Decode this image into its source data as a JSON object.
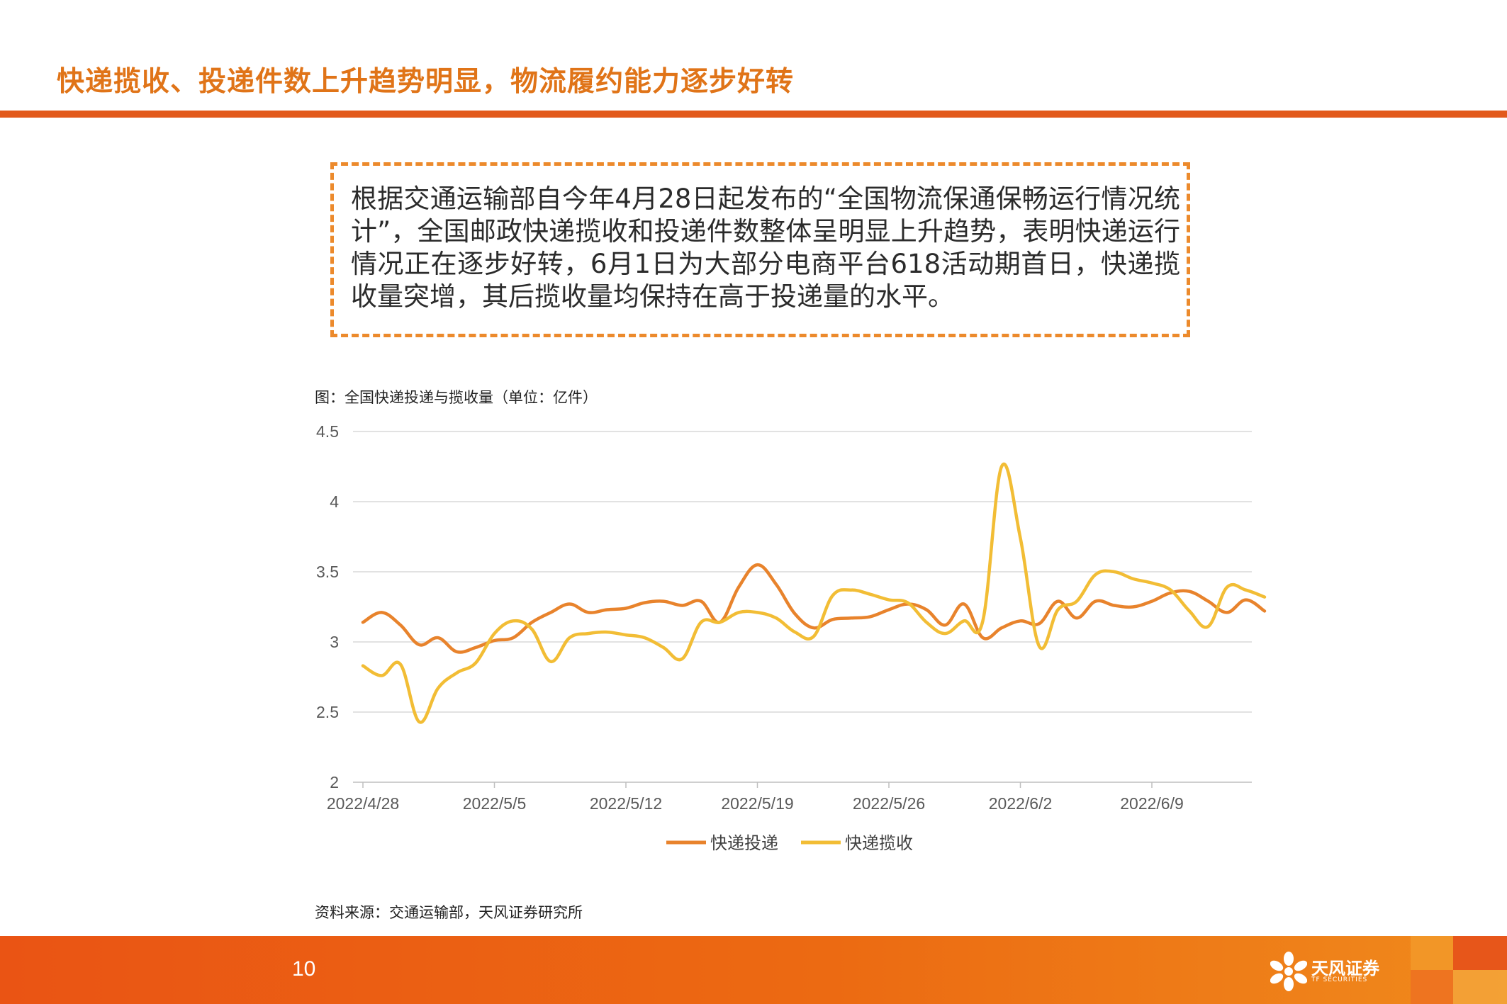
{
  "header": {
    "title": "快递揽收、投递件数上升趋势明显，物流履约能力逐步好转"
  },
  "callout": {
    "text": "根据交通运输部自今年4月28日起发布的“全国物流保通保畅运行情况统计”，全国邮政快递揽收和投递件数整体呈明显上升趋势，表明快递运行情况正在逐步好转，6月1日为大部分电商平台618活动期首日，快递揽收量突增，其后揽收量均保持在高于投递量的水平。"
  },
  "figure": {
    "caption": "图：全国快递投递与揽收量（单位：亿件）",
    "source": "资料来源：交通运输部，天风证券研究所"
  },
  "chart_data": {
    "type": "line",
    "title": "",
    "xlabel": "",
    "ylabel": "",
    "ylim": [
      2,
      4.5
    ],
    "yticks": [
      2,
      2.5,
      3,
      3.5,
      4,
      4.5
    ],
    "ytick_labels": [
      "2",
      "2.5",
      "3",
      "3.5",
      "4",
      "4.5"
    ],
    "x": [
      "2022/4/28",
      "2022/4/29",
      "2022/4/30",
      "2022/5/1",
      "2022/5/2",
      "2022/5/3",
      "2022/5/4",
      "2022/5/5",
      "2022/5/6",
      "2022/5/7",
      "2022/5/8",
      "2022/5/9",
      "2022/5/10",
      "2022/5/11",
      "2022/5/12",
      "2022/5/13",
      "2022/5/14",
      "2022/5/15",
      "2022/5/16",
      "2022/5/17",
      "2022/5/18",
      "2022/5/19",
      "2022/5/20",
      "2022/5/21",
      "2022/5/22",
      "2022/5/23",
      "2022/5/24",
      "2022/5/25",
      "2022/5/26",
      "2022/5/27",
      "2022/5/28",
      "2022/5/29",
      "2022/5/30",
      "2022/5/31",
      "2022/6/1",
      "2022/6/2",
      "2022/6/3",
      "2022/6/4",
      "2022/6/5",
      "2022/6/6",
      "2022/6/7",
      "2022/6/8",
      "2022/6/9",
      "2022/6/10",
      "2022/6/11",
      "2022/6/12",
      "2022/6/13",
      "2022/6/14",
      "2022/6/15"
    ],
    "xtick_labels": [
      "2022/4/28",
      "2022/5/5",
      "2022/5/12",
      "2022/5/19",
      "2022/5/26",
      "2022/6/2",
      "2022/6/9"
    ],
    "xtick_index": [
      0,
      7,
      14,
      21,
      28,
      35,
      42
    ],
    "series": [
      {
        "name": "快递投递",
        "color": "#e8832c",
        "values": [
          3.14,
          3.21,
          3.12,
          2.98,
          3.03,
          2.93,
          2.96,
          3.01,
          3.03,
          3.14,
          3.21,
          3.27,
          3.21,
          3.23,
          3.24,
          3.28,
          3.29,
          3.26,
          3.29,
          3.14,
          3.39,
          3.55,
          3.41,
          3.2,
          3.1,
          3.16,
          3.17,
          3.18,
          3.23,
          3.27,
          3.23,
          3.12,
          3.27,
          3.03,
          3.1,
          3.15,
          3.13,
          3.29,
          3.17,
          3.29,
          3.26,
          3.25,
          3.29,
          3.35,
          3.36,
          3.29,
          3.21,
          3.3,
          3.22
        ]
      },
      {
        "name": "快递揽收",
        "color": "#f2bd35",
        "values": [
          2.83,
          2.76,
          2.84,
          2.43,
          2.67,
          2.78,
          2.85,
          3.06,
          3.15,
          3.09,
          2.86,
          3.03,
          3.06,
          3.07,
          3.05,
          3.03,
          2.96,
          2.88,
          3.14,
          3.14,
          3.21,
          3.21,
          3.17,
          3.07,
          3.04,
          3.33,
          3.37,
          3.34,
          3.3,
          3.28,
          3.14,
          3.06,
          3.15,
          3.15,
          4.25,
          3.74,
          2.97,
          3.23,
          3.29,
          3.48,
          3.5,
          3.45,
          3.42,
          3.37,
          3.22,
          3.11,
          3.39,
          3.37,
          3.32
        ]
      }
    ],
    "legend_position": "bottom-center",
    "grid": true
  },
  "footer": {
    "page_number": "10",
    "logo_text": "天风证券",
    "logo_sub": "TF SECURITIES"
  }
}
